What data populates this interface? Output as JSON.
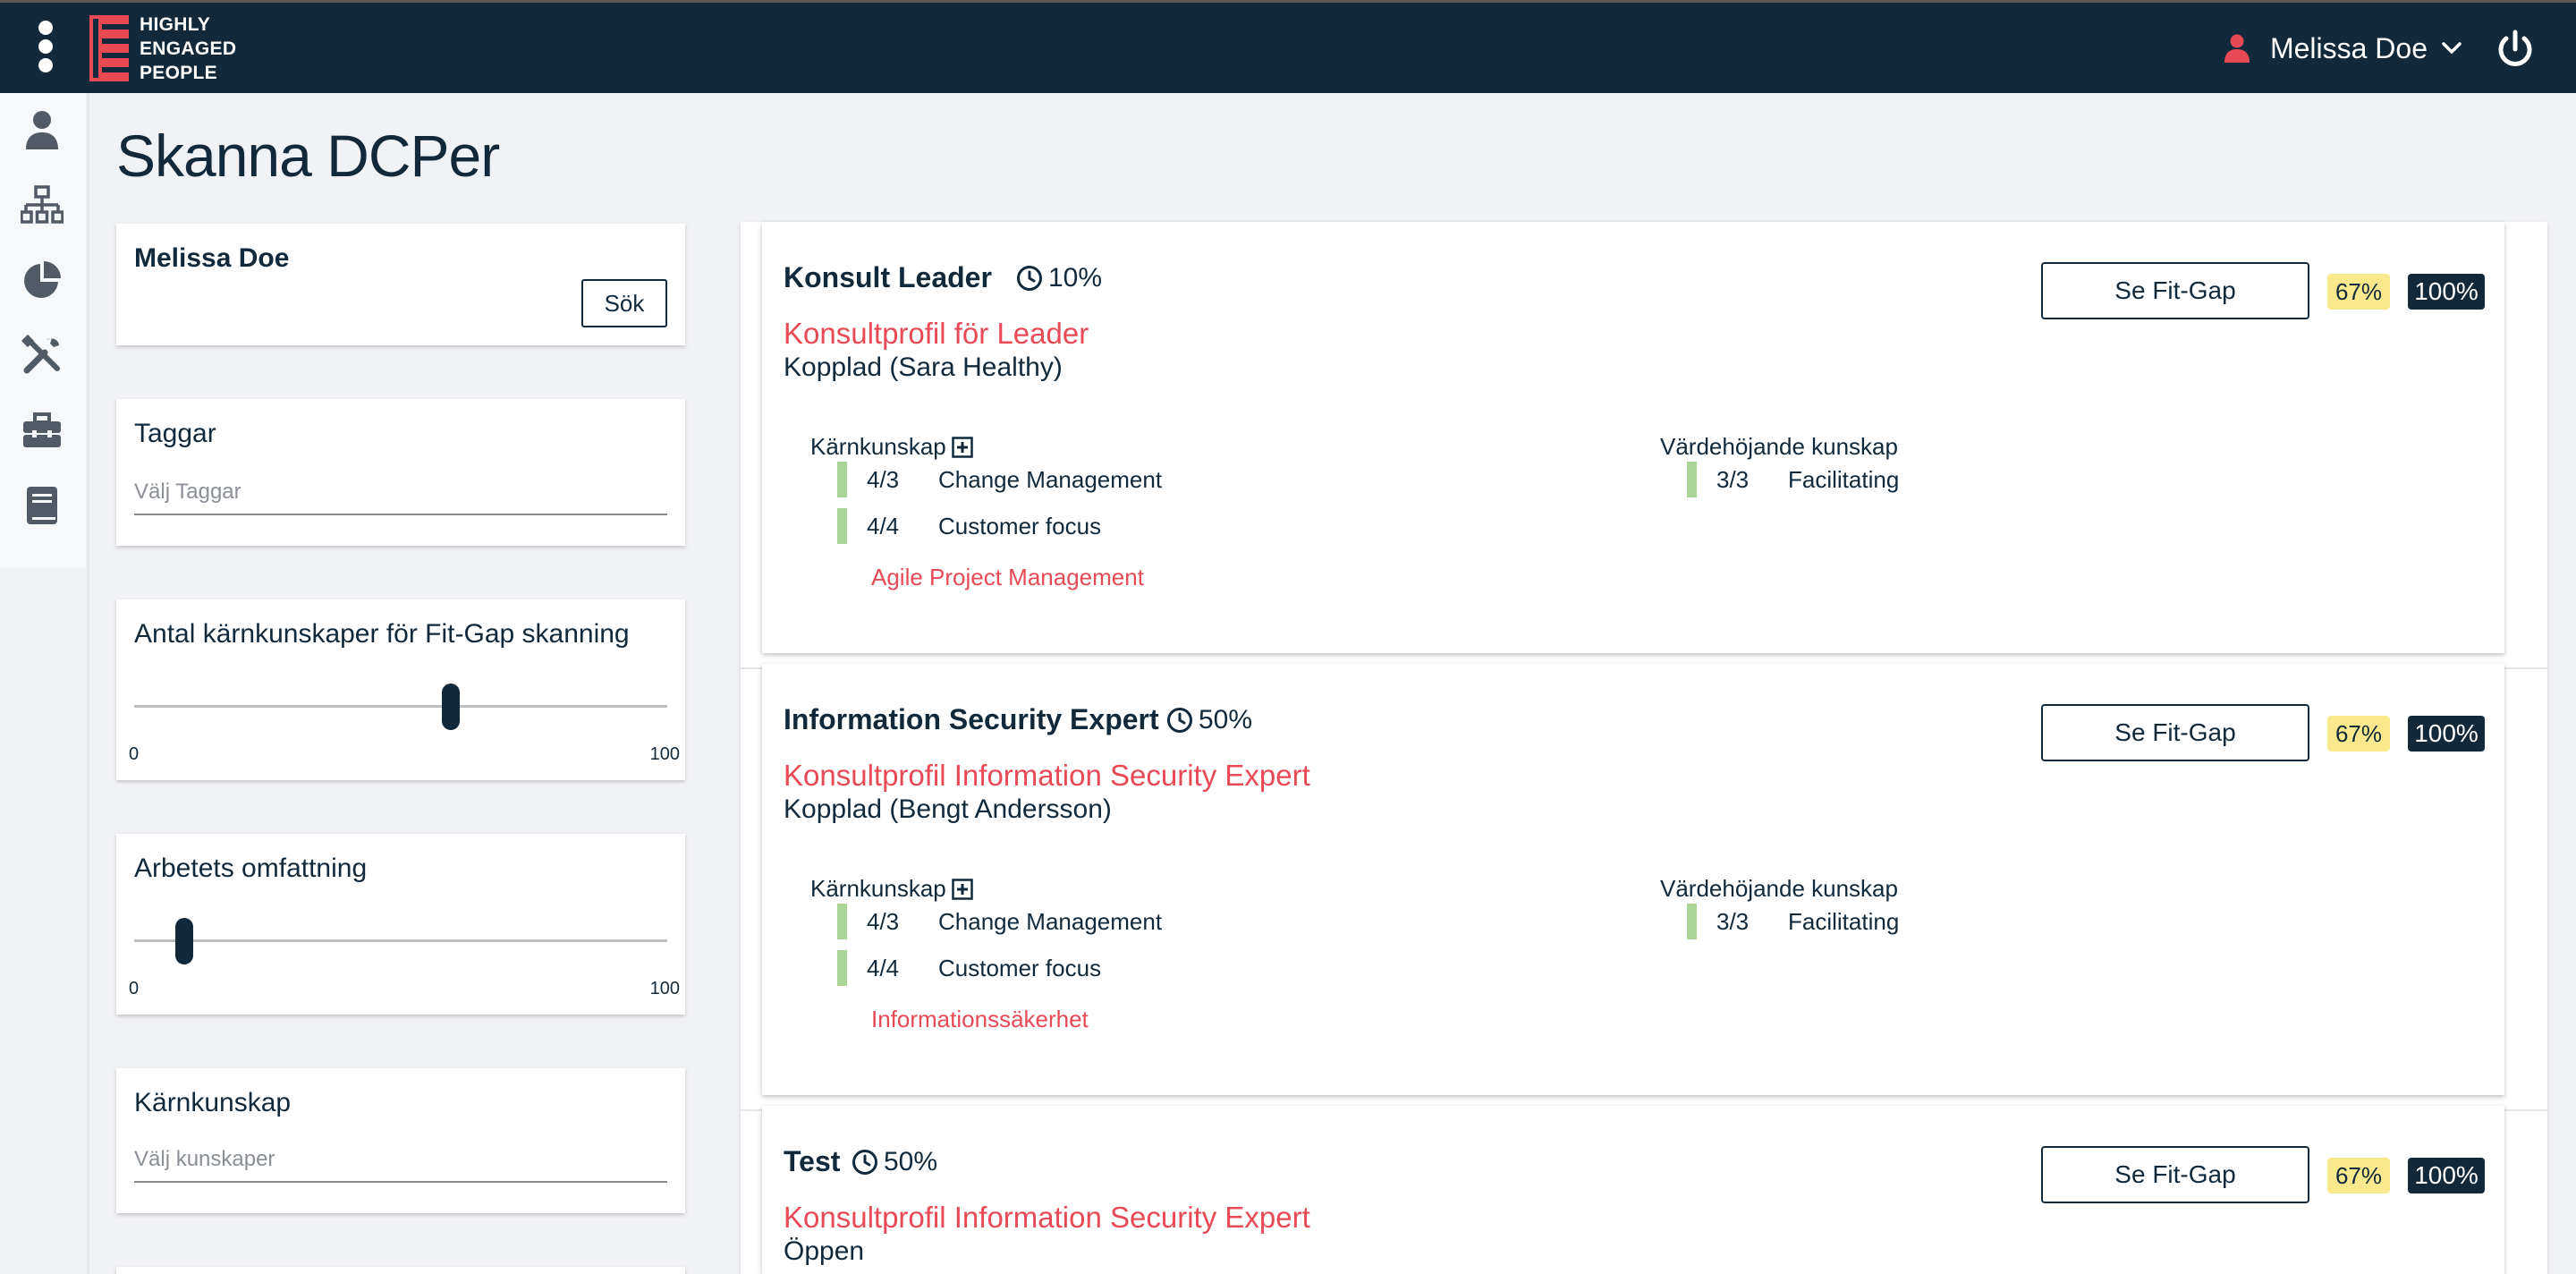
{
  "header": {
    "logo_lines": [
      "HIGHLY",
      "ENGAGED",
      "PEOPLE"
    ],
    "user_name": "Melissa Doe"
  },
  "sidenav": {
    "items": [
      {
        "icon": "user-icon"
      },
      {
        "icon": "org-chart-icon"
      },
      {
        "icon": "pie-chart-icon"
      },
      {
        "icon": "tools-icon"
      },
      {
        "icon": "toolbox-icon"
      },
      {
        "icon": "book-icon"
      }
    ]
  },
  "page": {
    "title": "Skanna DCPer"
  },
  "filters": {
    "person": {
      "name": "Melissa Doe",
      "search_label": "Sök"
    },
    "tags": {
      "title": "Taggar",
      "placeholder": "Välj Taggar"
    },
    "core_count": {
      "title": "Antal kärnkunskaper för Fit-Gap skanning",
      "min": "0",
      "max": "100",
      "value": 58
    },
    "scope": {
      "title": "Arbetets omfattning",
      "min": "0",
      "max": "100",
      "value": 8
    },
    "core_skill": {
      "title": "Kärnkunskap",
      "placeholder": "Välj kunskaper"
    }
  },
  "results": [
    {
      "title": "Konsult Leader",
      "time": "10%",
      "profile_link": "Konsultprofil för Leader",
      "status": "Kopplad (Sara Healthy)",
      "fitgap_label": "Se Fit-Gap",
      "badge_match": "67%",
      "badge_total": "100%",
      "core_heading": "Kärnkunskap",
      "core_skills": [
        {
          "level": "4/3",
          "name": "Change Management"
        },
        {
          "level": "4/4",
          "name": "Customer focus"
        }
      ],
      "core_missing": "Agile Project Management",
      "value_heading": "Värdehöjande kunskap",
      "value_skills": [
        {
          "level": "3/3",
          "name": "Facilitating"
        }
      ]
    },
    {
      "title": "Information Security Expert",
      "time": "50%",
      "profile_link": "Konsultprofil Information Security Expert",
      "status": "Kopplad (Bengt Andersson)",
      "fitgap_label": "Se Fit-Gap",
      "badge_match": "67%",
      "badge_total": "100%",
      "core_heading": "Kärnkunskap",
      "core_skills": [
        {
          "level": "4/3",
          "name": "Change Management"
        },
        {
          "level": "4/4",
          "name": "Customer focus"
        }
      ],
      "core_missing": "Informationssäkerhet",
      "value_heading": "Värdehöjande kunskap",
      "value_skills": [
        {
          "level": "3/3",
          "name": "Facilitating"
        }
      ]
    },
    {
      "title": "Test",
      "time": "50%",
      "profile_link": "Konsultprofil Information Security Expert",
      "status": "Öppen",
      "fitgap_label": "Se Fit-Gap",
      "badge_match": "67%",
      "badge_total": "100%"
    }
  ]
}
